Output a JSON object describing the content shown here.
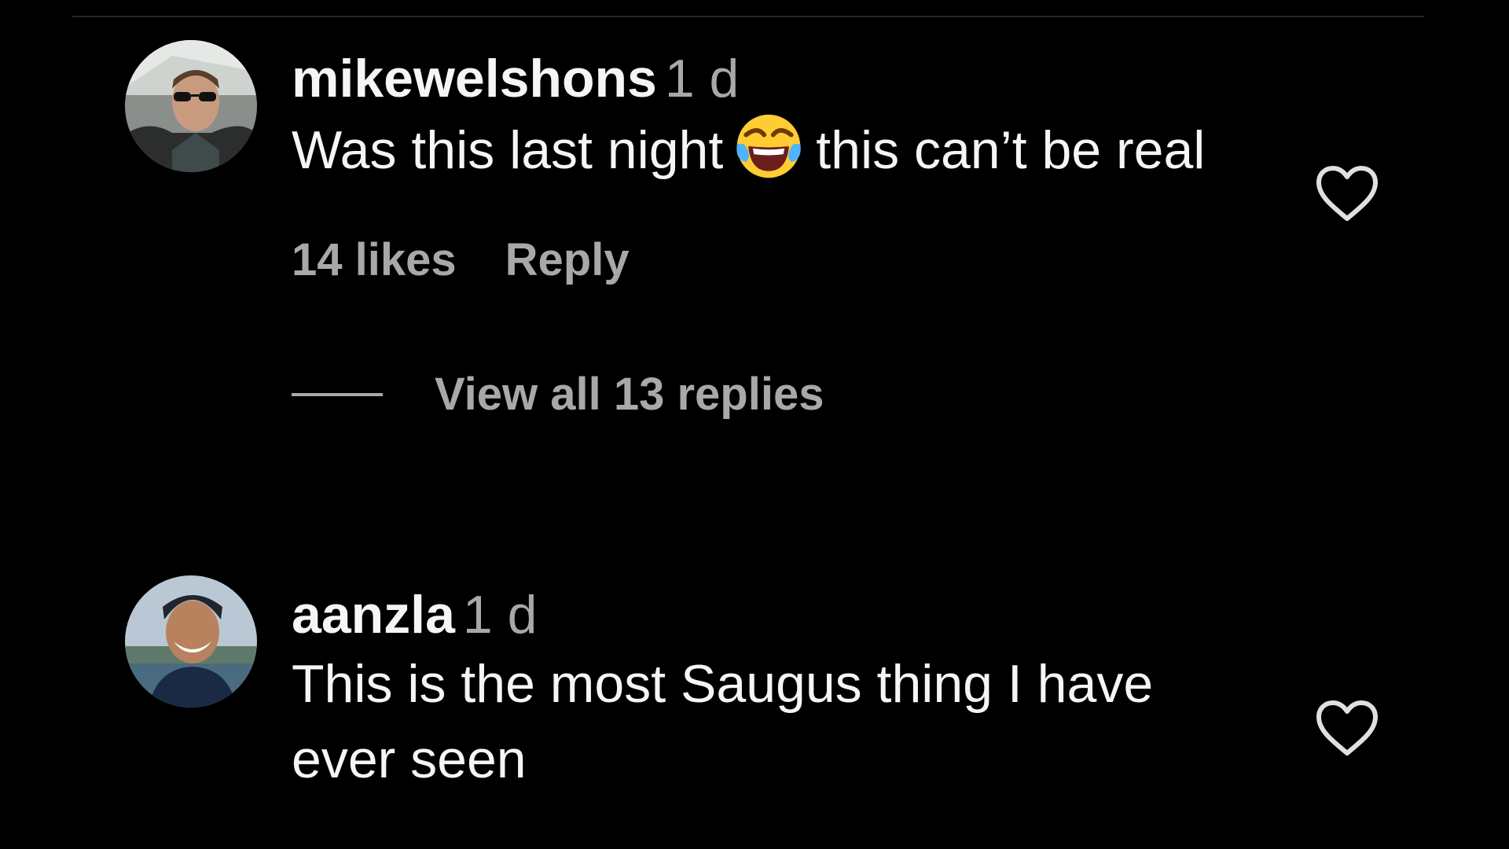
{
  "comments": [
    {
      "username": "mikewelshons",
      "time": "1 d",
      "text_before": "Was this last night",
      "emoji": "face-with-tears-of-joy",
      "text_after": "this can’t be real",
      "likes": "14 likes",
      "reply_label": "Reply",
      "view_replies": "View all 13 replies"
    },
    {
      "username": "aanzla",
      "time": "1 d",
      "text": "This is the most Saugus thing I have ever seen"
    }
  ],
  "icons": {
    "like": "heart-outline-icon"
  },
  "colors": {
    "background": "#000000",
    "primary_text": "#f5f5f5",
    "secondary_text": "#a8a8a8",
    "divider": "#262626"
  }
}
